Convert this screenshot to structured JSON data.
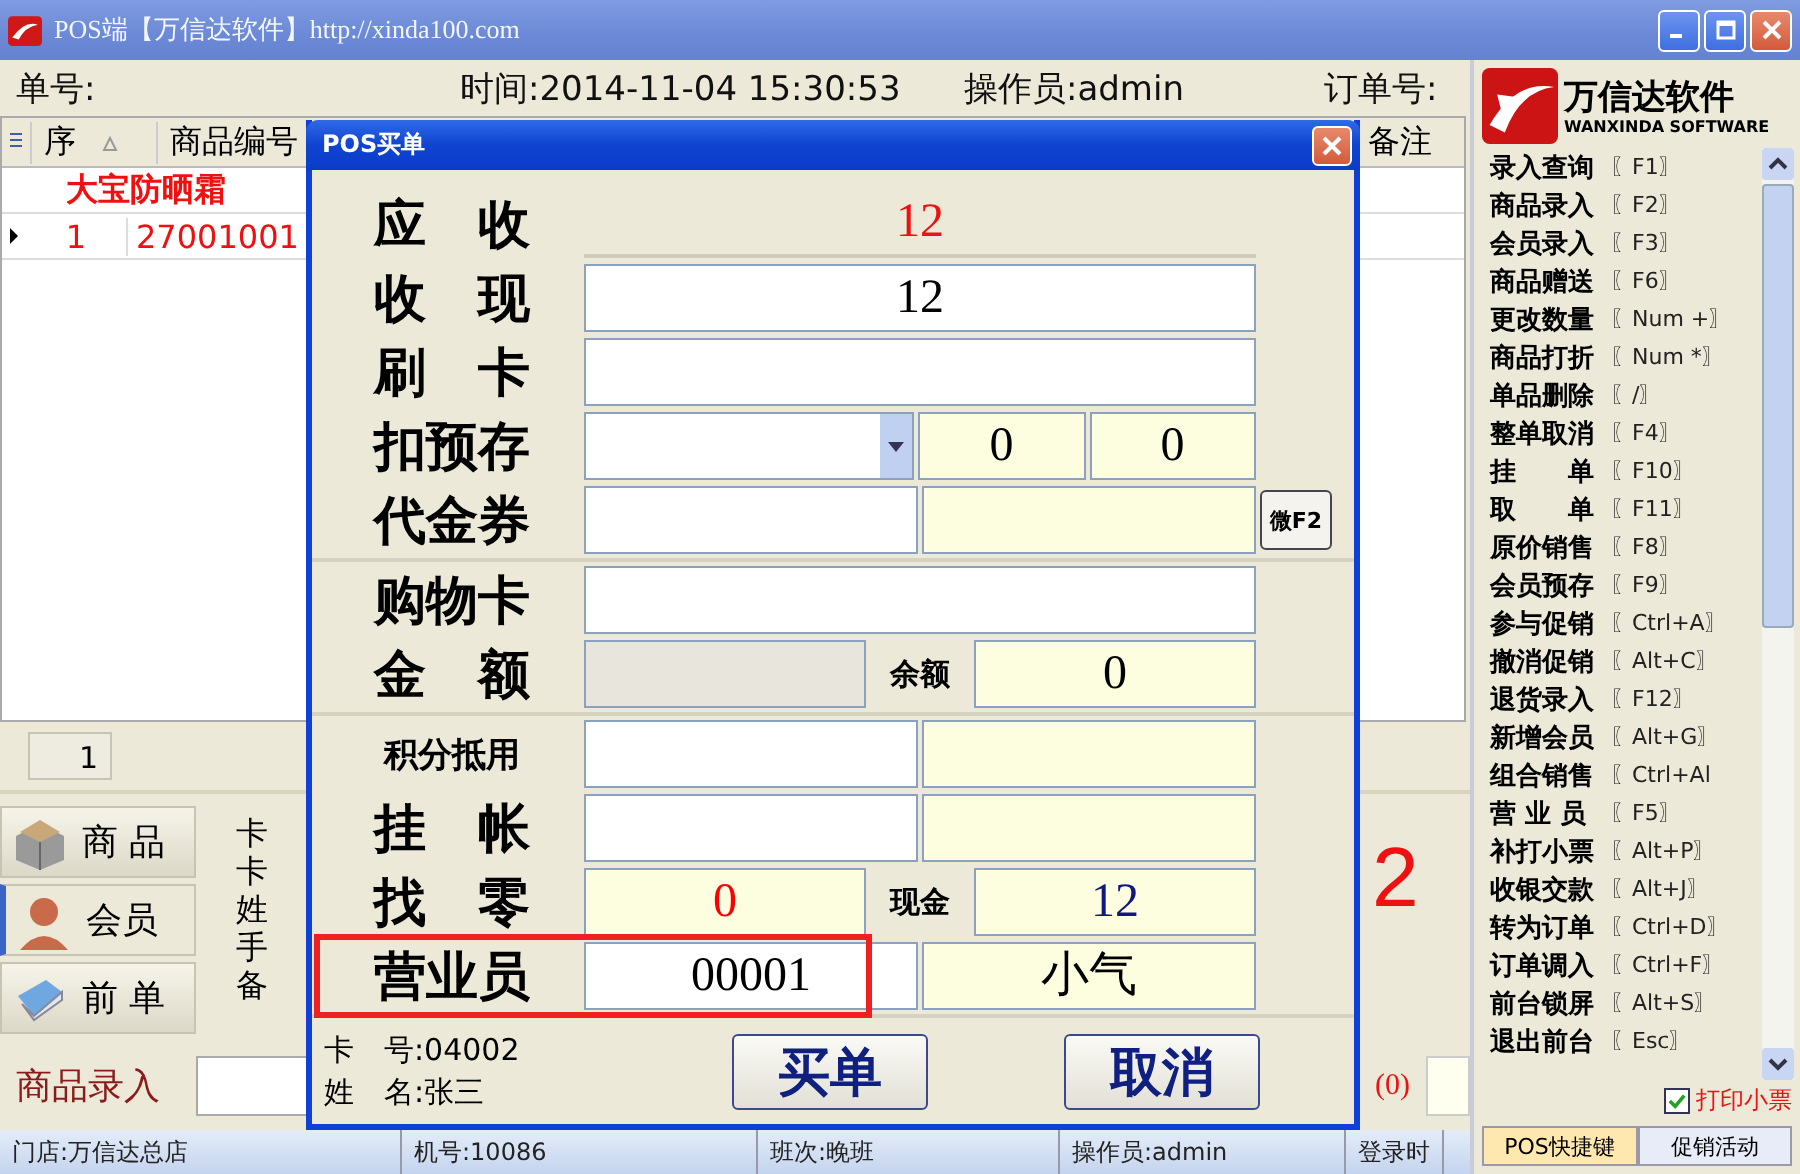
{
  "window": {
    "title": "POS端【万信达软件】http://xinda100.com"
  },
  "header": {
    "order_no": "单号:",
    "time": "时间:2014-11-04 15:30:53",
    "operator": "操作员:admin",
    "order_ref": "订单号:"
  },
  "grid": {
    "columns": [
      "序",
      "商品编号",
      "备注"
    ],
    "group_row": "大宝防晒霜",
    "rows": [
      {
        "cells": [
          "1",
          "27001001"
        ],
        "selected": true
      }
    ]
  },
  "pager": {
    "page": "1"
  },
  "side_tabs": [
    {
      "label": "商 品",
      "selected": false
    },
    {
      "label": "会员",
      "selected": true
    },
    {
      "label": "前 单",
      "selected": false
    }
  ],
  "member_fields": [
    "卡",
    "卡",
    "姓",
    "手",
    "备"
  ],
  "total_fragment": "2",
  "entry": {
    "label": "商品录入",
    "count": "(0)"
  },
  "status_bar": [
    "门店:万信达总店",
    "机号:10086",
    "班次:晚班",
    "操作员:admin",
    "登录时"
  ],
  "dialog": {
    "title": "POS买单",
    "sections": [
      {
        "rows": [
          {
            "label": "应　收",
            "highlighted": false,
            "fields": [
              {
                "kind": "total",
                "value": "12"
              }
            ]
          },
          {
            "label": "收　现",
            "highlighted": false,
            "fields": [
              {
                "kind": "input",
                "value": "12"
              }
            ]
          },
          {
            "label": "刷　卡",
            "highlighted": false,
            "fields": [
              {
                "kind": "input"
              }
            ]
          },
          {
            "label": "扣预存",
            "highlighted": false,
            "fields": [
              {
                "kind": "select"
              },
              {
                "kind": "readout",
                "value": "0"
              },
              {
                "kind": "readout",
                "value": "0"
              }
            ]
          },
          {
            "label": "代金券",
            "highlighted": false,
            "fields": [
              {
                "kind": "input"
              },
              {
                "kind": "readout"
              },
              {
                "kind": "button",
                "value": "微F2"
              }
            ]
          }
        ]
      },
      {
        "rows": [
          {
            "label": "购物卡",
            "highlighted": false,
            "fields": [
              {
                "kind": "input"
              }
            ]
          },
          {
            "label": "金　额",
            "highlighted": false,
            "fields": [
              {
                "kind": "grey"
              },
              {
                "kind": "caption",
                "value": "余额"
              },
              {
                "kind": "readout",
                "value": "0"
              }
            ]
          }
        ]
      },
      {
        "rows": [
          {
            "label": "积分抵用",
            "highlighted": false,
            "fields": [
              {
                "kind": "input"
              },
              {
                "kind": "readout"
              }
            ]
          },
          {
            "label": "挂　帐",
            "highlighted": false,
            "fields": [
              {
                "kind": "input"
              },
              {
                "kind": "readout"
              }
            ]
          },
          {
            "label": "找　零",
            "highlighted": false,
            "fields": [
              {
                "kind": "readout",
                "value": "0",
                "color": "#ff0000"
              },
              {
                "kind": "caption",
                "value": "现金"
              },
              {
                "kind": "readout",
                "value": "12",
                "color": "#101880"
              }
            ]
          },
          {
            "label": "营业员",
            "highlighted": true,
            "fields": [
              {
                "kind": "input",
                "value": "00001"
              },
              {
                "kind": "readout",
                "value": "小气"
              }
            ]
          }
        ]
      }
    ],
    "card_no": "卡　号:04002",
    "member_name": "姓　名:张三",
    "buttons": [
      "买单",
      "取消"
    ]
  },
  "shortcuts": {
    "logo": {
      "name": "万信达软件",
      "tagline": "WANXINDA SOFTWARE"
    },
    "items": [
      {
        "name": "录入查询",
        "key": "〖F1〗"
      },
      {
        "name": "商品录入",
        "key": "〖F2〗"
      },
      {
        "name": "会员录入",
        "key": "〖F3〗"
      },
      {
        "name": "商品赠送",
        "key": "〖F6〗"
      },
      {
        "name": "更改数量",
        "key": "〖Num +〗"
      },
      {
        "name": "商品打折",
        "key": "〖Num *〗"
      },
      {
        "name": "单品删除",
        "key": "〖/〗"
      },
      {
        "name": "整单取消",
        "key": "〖F4〗"
      },
      {
        "name": "挂　　单",
        "key": "〖F10〗"
      },
      {
        "name": "取　　单",
        "key": "〖F11〗"
      },
      {
        "name": "原价销售",
        "key": "〖F8〗"
      },
      {
        "name": "会员预存",
        "key": "〖F9〗"
      },
      {
        "name": "参与促销",
        "key": "〖Ctrl+A〗"
      },
      {
        "name": "撤消促销",
        "key": "〖Alt+C〗"
      },
      {
        "name": "退货录入",
        "key": "〖F12〗"
      },
      {
        "name": "新增会员",
        "key": "〖Alt+G〗"
      },
      {
        "name": "组合销售",
        "key": "〖Ctrl+Al"
      },
      {
        "name": "营 业 员",
        "key": "〖F5〗"
      },
      {
        "name": "补打小票",
        "key": "〖Alt+P〗"
      },
      {
        "name": "收银交款",
        "key": "〖Alt+J〗"
      },
      {
        "name": "转为订单",
        "key": "〖Ctrl+D〗"
      },
      {
        "name": "订单调入",
        "key": "〖Ctrl+F〗"
      },
      {
        "name": "前台锁屏",
        "key": "〖Alt+S〗"
      },
      {
        "name": "退出前台",
        "key": "〖Esc〗"
      }
    ],
    "print_receipt": {
      "label": "打印小票",
      "checked": true
    },
    "tabs": [
      {
        "label": "POS快捷键",
        "selected": true
      },
      {
        "label": "促销活动",
        "selected": false
      }
    ]
  }
}
